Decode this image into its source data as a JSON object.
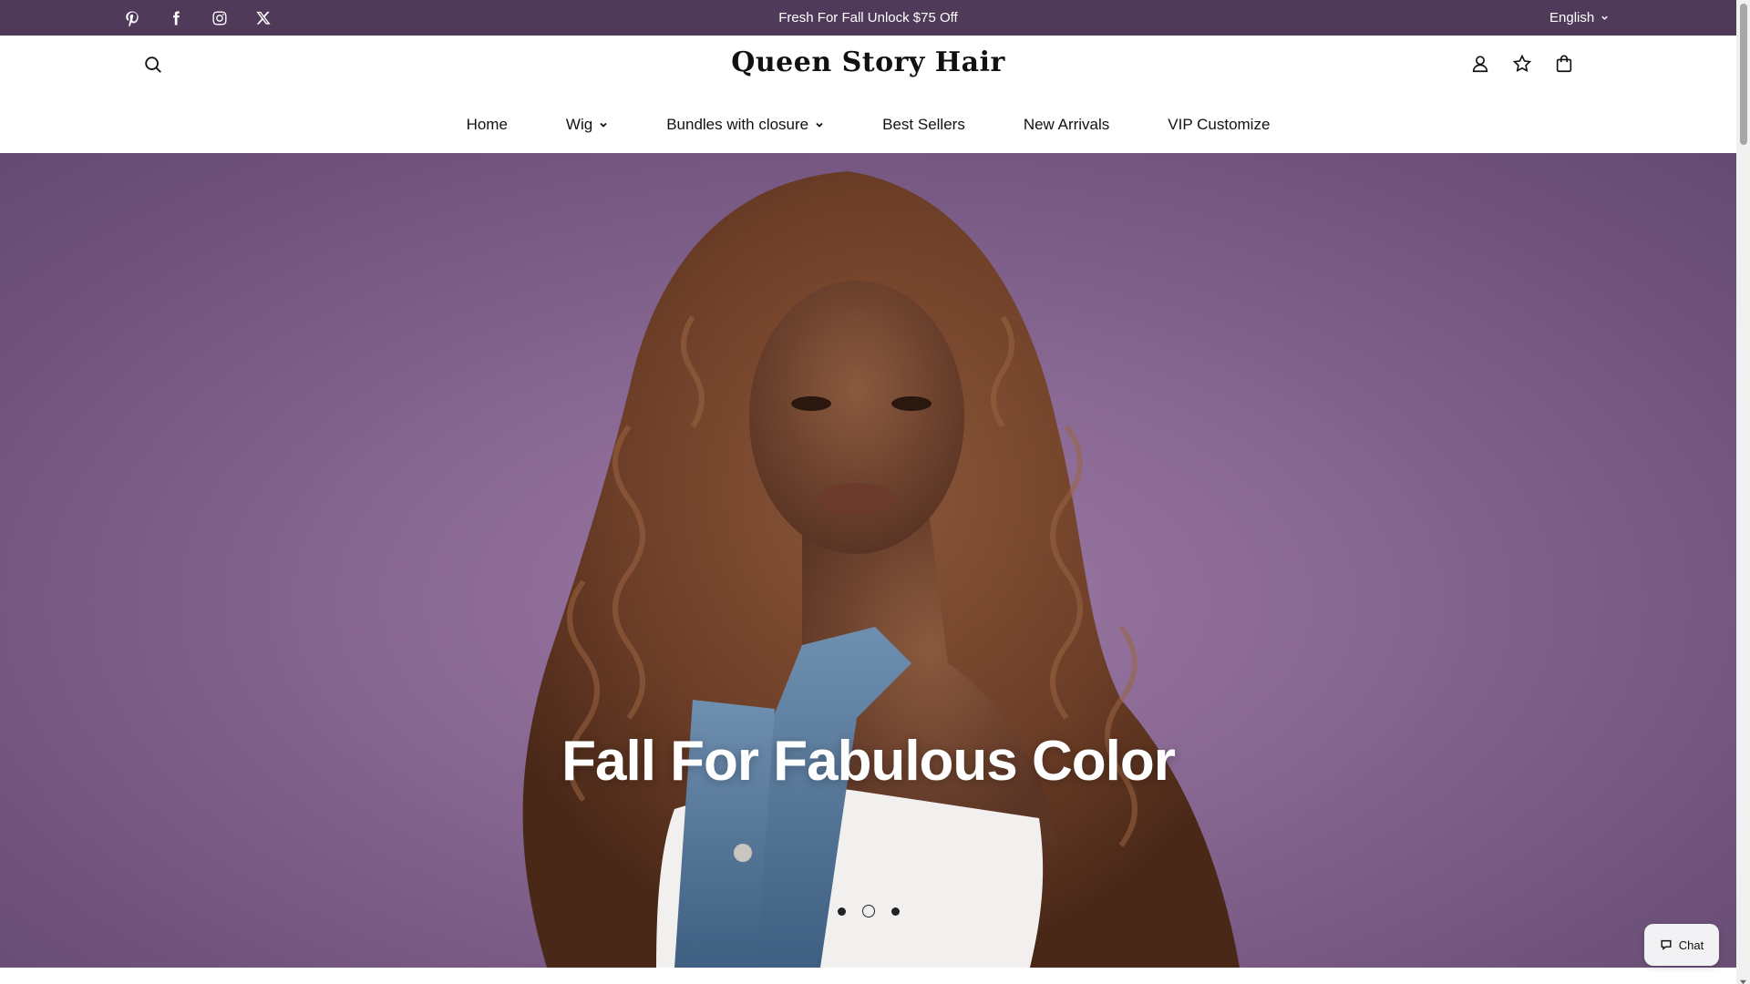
{
  "topbar": {
    "social": [
      {
        "name": "pinterest-icon"
      },
      {
        "name": "facebook-icon"
      },
      {
        "name": "instagram-icon"
      },
      {
        "name": "x-twitter-icon"
      }
    ],
    "announcement": "Fresh For Fall Unlock $75 Off",
    "language": "English",
    "bg_color": "#4f3b59"
  },
  "header": {
    "logo": "Queen Story Hair",
    "actions": [
      "search-icon",
      "account-icon",
      "wishlist-star-icon",
      "cart-bag-icon"
    ]
  },
  "nav": {
    "items": [
      {
        "label": "Home",
        "dropdown": false
      },
      {
        "label": "Wig",
        "dropdown": true
      },
      {
        "label": "Bundles with closure",
        "dropdown": true
      },
      {
        "label": "Best Sellers",
        "dropdown": false
      },
      {
        "label": "New Arrivals",
        "dropdown": false
      },
      {
        "label": "VIP Customize",
        "dropdown": false
      }
    ]
  },
  "hero": {
    "title": "Fall For Fabulous Color",
    "slides_count": 3,
    "active_slide": 2,
    "bg_color": "#8a6a95"
  },
  "chat": {
    "label": "Chat"
  }
}
